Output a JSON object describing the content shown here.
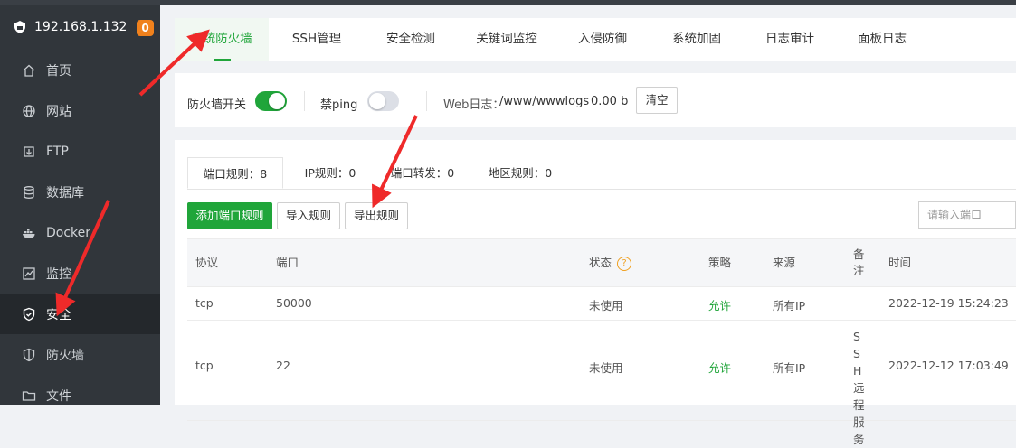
{
  "sidebar": {
    "ip": "192.168.1.132",
    "badge": "0",
    "items": [
      {
        "label": "首页",
        "icon": "home-icon"
      },
      {
        "label": "网站",
        "icon": "globe-icon"
      },
      {
        "label": "FTP",
        "icon": "ftp-icon"
      },
      {
        "label": "数据库",
        "icon": "database-icon"
      },
      {
        "label": "Docker",
        "icon": "docker-icon"
      },
      {
        "label": "监控",
        "icon": "monitor-icon"
      },
      {
        "label": "安全",
        "icon": "shield-icon"
      },
      {
        "label": "防火墙",
        "icon": "firewall-icon"
      },
      {
        "label": "文件",
        "icon": "folder-icon"
      }
    ]
  },
  "tabs": [
    "系统防火墙",
    "SSH管理",
    "安全检测",
    "关键词监控",
    "入侵防御",
    "系统加固",
    "日志审计",
    "面板日志"
  ],
  "controls": {
    "firewall_label": "防火墙开关",
    "firewall_on": true,
    "ping_label": "禁ping",
    "ping_on": false,
    "weblog_label": "Web日志：",
    "weblog_path": "/www/wwwlogs",
    "weblog_size": "0.00 b",
    "clear_label": "清空"
  },
  "subtabs": [
    "端口规则：8",
    "IP规则：0",
    "端口转发：0",
    "地区规则：0"
  ],
  "actions": {
    "add": "添加端口规则",
    "import": "导入规则",
    "export": "导出规则",
    "search_placeholder": "请输入端口"
  },
  "table": {
    "headers": [
      "协议",
      "端口",
      "状态",
      "策略",
      "来源",
      "备注",
      "时间"
    ],
    "rows": [
      {
        "protocol": "tcp",
        "port": "50000",
        "status": "未使用",
        "policy": "允许",
        "source": "所有IP",
        "note": "",
        "time": "2022-12-19 15:24:23"
      },
      {
        "protocol": "tcp",
        "port": "22",
        "status": "未使用",
        "policy": "允许",
        "source": "所有IP",
        "note": "SSH远程服务",
        "time": "2022-12-12 17:03:49"
      }
    ]
  },
  "colors": {
    "accent": "#20a53a",
    "sidebar": "#31363b",
    "badge": "#f0811c",
    "arrow": "#ef2a2a"
  }
}
